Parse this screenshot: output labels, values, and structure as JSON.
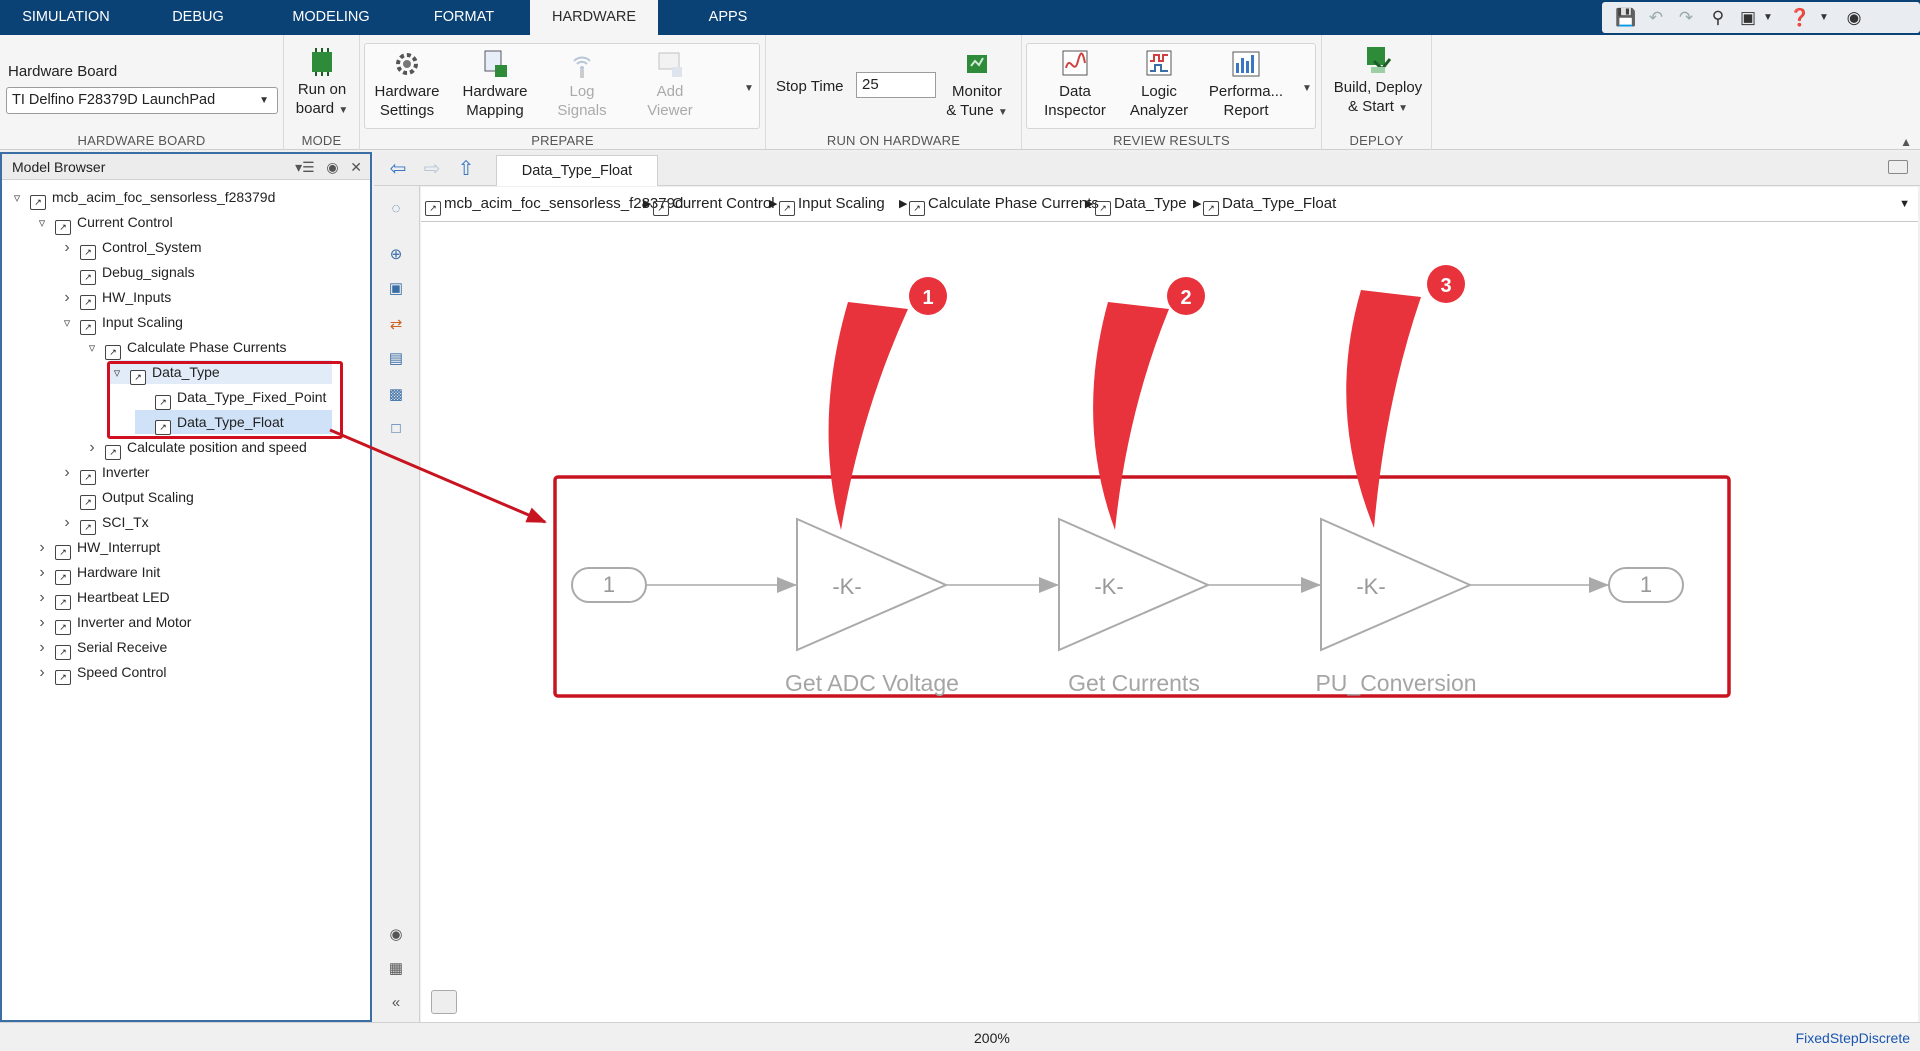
{
  "tabs": [
    "SIMULATION",
    "DEBUG",
    "MODELING",
    "FORMAT",
    "HARDWARE",
    "APPS"
  ],
  "active_tab": "HARDWARE",
  "toolstrip": {
    "hardware_board": {
      "label": "Hardware Board",
      "value": "TI Delfino F28379D LaunchPad",
      "section": "HARDWARE BOARD"
    },
    "mode": {
      "run_on_board_line1": "Run on",
      "run_on_board_line2": "board",
      "section": "MODE"
    },
    "prepare": {
      "hardware_settings_1": "Hardware",
      "hardware_settings_2": "Settings",
      "hardware_mapping_1": "Hardware",
      "hardware_mapping_2": "Mapping",
      "log_signals_1": "Log",
      "log_signals_2": "Signals",
      "add_viewer_1": "Add",
      "add_viewer_2": "Viewer",
      "section": "PREPARE"
    },
    "run_on_hardware": {
      "stop_time_label": "Stop Time",
      "stop_time_value": "25",
      "monitor_1": "Monitor",
      "monitor_2": "& Tune",
      "section": "RUN ON HARDWARE"
    },
    "review_results": {
      "data_inspector_1": "Data",
      "data_inspector_2": "Inspector",
      "logic_analyzer_1": "Logic",
      "logic_analyzer_2": "Analyzer",
      "performance_1": "Performa...",
      "performance_2": "Report",
      "section": "REVIEW RESULTS"
    },
    "deploy": {
      "build_1": "Build, Deploy",
      "build_2": "& Start",
      "section": "DEPLOY"
    }
  },
  "model_browser": {
    "title": "Model Browser",
    "tree": [
      {
        "label": "mcb_acim_foc_sensorless_f28379d",
        "level": 0,
        "chevron": "down"
      },
      {
        "label": "Current Control",
        "level": 1,
        "chevron": "down"
      },
      {
        "label": "Control_System",
        "level": 2,
        "chevron": "right"
      },
      {
        "label": "Debug_signals",
        "level": 2,
        "chevron": ""
      },
      {
        "label": "HW_Inputs",
        "level": 2,
        "chevron": "right"
      },
      {
        "label": "Input Scaling",
        "level": 2,
        "chevron": "down"
      },
      {
        "label": "Calculate Phase Currents",
        "level": 3,
        "chevron": "down"
      },
      {
        "label": "Data_Type",
        "level": 4,
        "chevron": "down"
      },
      {
        "label": "Data_Type_Fixed_Point",
        "level": 5,
        "chevron": ""
      },
      {
        "label": "Data_Type_Float",
        "level": 5,
        "chevron": ""
      },
      {
        "label": "Calculate position and speed",
        "level": 3,
        "chevron": "right"
      },
      {
        "label": "Inverter",
        "level": 2,
        "chevron": "right"
      },
      {
        "label": "Output Scaling",
        "level": 2,
        "chevron": ""
      },
      {
        "label": "SCI_Tx",
        "level": 2,
        "chevron": "right"
      },
      {
        "label": "HW_Interrupt",
        "level": 1,
        "chevron": "right"
      },
      {
        "label": "Hardware Init",
        "level": 1,
        "chevron": "right"
      },
      {
        "label": "Heartbeat LED",
        "level": 1,
        "chevron": "right"
      },
      {
        "label": "Inverter and Motor",
        "level": 1,
        "chevron": "right"
      },
      {
        "label": "Serial Receive",
        "level": 1,
        "chevron": "right"
      },
      {
        "label": "Speed Control",
        "level": 1,
        "chevron": "right"
      }
    ],
    "selected": "Data_Type_Float"
  },
  "editor": {
    "tab_title": "Data_Type_Float",
    "breadcrumbs": [
      "mcb_acim_foc_sensorless_f28379d",
      "Current Control",
      "Input Scaling",
      "Calculate Phase Currents",
      "Data_Type",
      "Data_Type_Float"
    ],
    "diagram": {
      "inport_label": "1",
      "outport_label": "1",
      "gains": [
        {
          "symbol": "-K-",
          "name": "Get ADC Voltage",
          "callout": "1"
        },
        {
          "symbol": "-K-",
          "name": "Get Currents",
          "callout": "2"
        },
        {
          "symbol": "-K-",
          "name": "PU_Conversion",
          "callout": "3"
        }
      ]
    }
  },
  "status": {
    "zoom": "200%",
    "solver": "FixedStepDiscrete"
  },
  "colors": {
    "accent": "#0b4275",
    "highlight": "#d01020",
    "callout": "#e8323c",
    "block_gray": "#a8a8a8"
  }
}
